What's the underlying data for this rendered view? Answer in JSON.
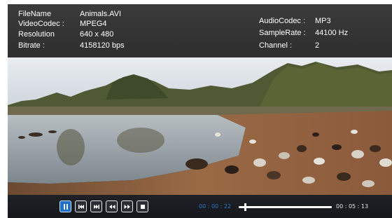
{
  "file_info": {
    "left": [
      {
        "key": "FileName",
        "value": "Animals.AVI"
      },
      {
        "key": "VideoCodec :",
        "value": "MPEG4"
      },
      {
        "key": "Resolution",
        "value": "640 x 480"
      },
      {
        "key": "Bitrate :",
        "value": "4158120 bps"
      }
    ],
    "right": [
      {
        "key": "AudioCodec :",
        "value": "MP3"
      },
      {
        "key": "SampleRate :",
        "value": "44100 Hz"
      },
      {
        "key": "Channel :",
        "value": "2"
      }
    ]
  },
  "video": {
    "content": "landscape scene with lake, trees and goats",
    "sky_color": "#dfe6ec",
    "water_color": "#9aa6ac",
    "ground_color": "#8a6040"
  },
  "controls": {
    "buttons": [
      {
        "name": "pause-button",
        "icon": "pause-icon",
        "active": true
      },
      {
        "name": "previous-button",
        "icon": "skip-back-icon",
        "active": false
      },
      {
        "name": "next-button",
        "icon": "skip-forward-icon",
        "active": false
      },
      {
        "name": "rewind-button",
        "icon": "rewind-icon",
        "active": false
      },
      {
        "name": "fast-forward-button",
        "icon": "fast-forward-icon",
        "active": false
      },
      {
        "name": "stop-button",
        "icon": "stop-icon",
        "active": false
      }
    ],
    "current_time": "00 : 00 : 22",
    "total_time": "00 : 05 : 13",
    "progress": 0.07,
    "accent_color": "#1d6fc9"
  }
}
